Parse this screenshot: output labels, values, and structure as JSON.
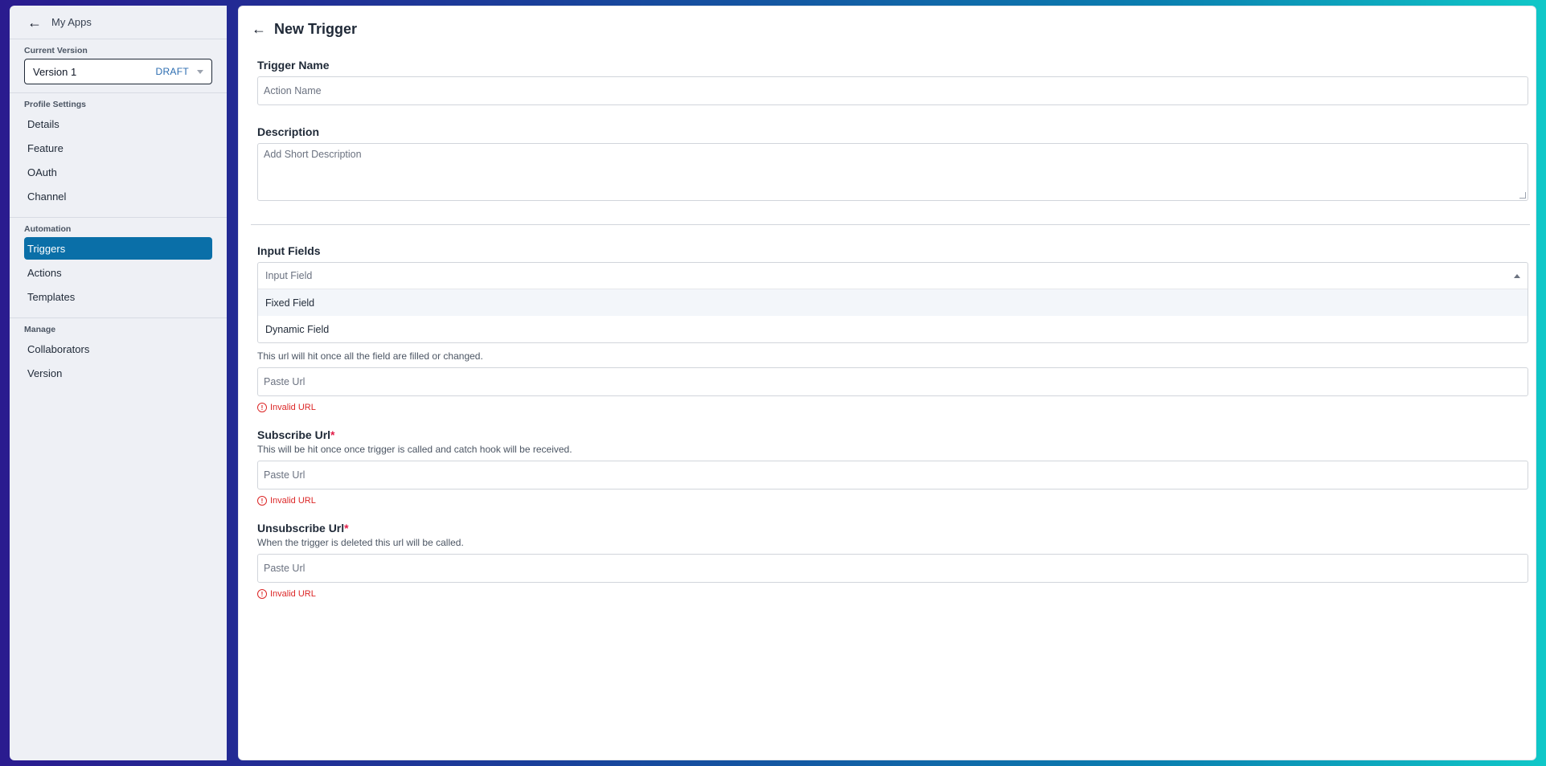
{
  "sidebar": {
    "back_label": "My Apps",
    "current_version_title": "Current Version",
    "version_name": "Version 1",
    "version_status": "DRAFT",
    "sections": [
      {
        "title": "Profile Settings",
        "items": [
          "Details",
          "Feature",
          "OAuth",
          "Channel"
        ]
      },
      {
        "title": "Automation",
        "items": [
          "Triggers",
          "Actions",
          "Templates"
        ]
      },
      {
        "title": "Manage",
        "items": [
          "Collaborators",
          "Version"
        ]
      }
    ],
    "active_item": "Triggers"
  },
  "header": {
    "title": "New Trigger"
  },
  "form": {
    "trigger_name": {
      "label": "Trigger Name",
      "placeholder": "Action Name"
    },
    "description": {
      "label": "Description",
      "placeholder": "Add Short Description"
    },
    "input_fields": {
      "label": "Input Fields",
      "placeholder": "Input Field",
      "options": [
        "Fixed Field",
        "Dynamic Field"
      ]
    },
    "hidden_url": {
      "hint": "This url will hit once all the field are filled or changed.",
      "placeholder": "Paste Url",
      "error": "Invalid URL"
    },
    "subscribe_url": {
      "label": "Subscribe Url",
      "required_mark": "*",
      "hint": "This will be hit once once trigger is called and catch hook will be received.",
      "placeholder": "Paste Url",
      "error": "Invalid URL"
    },
    "unsubscribe_url": {
      "label": "Unsubscribe Url",
      "required_mark": "*",
      "hint": "When the trigger is deleted this url will be called.",
      "placeholder": "Paste Url",
      "error": "Invalid URL"
    }
  }
}
